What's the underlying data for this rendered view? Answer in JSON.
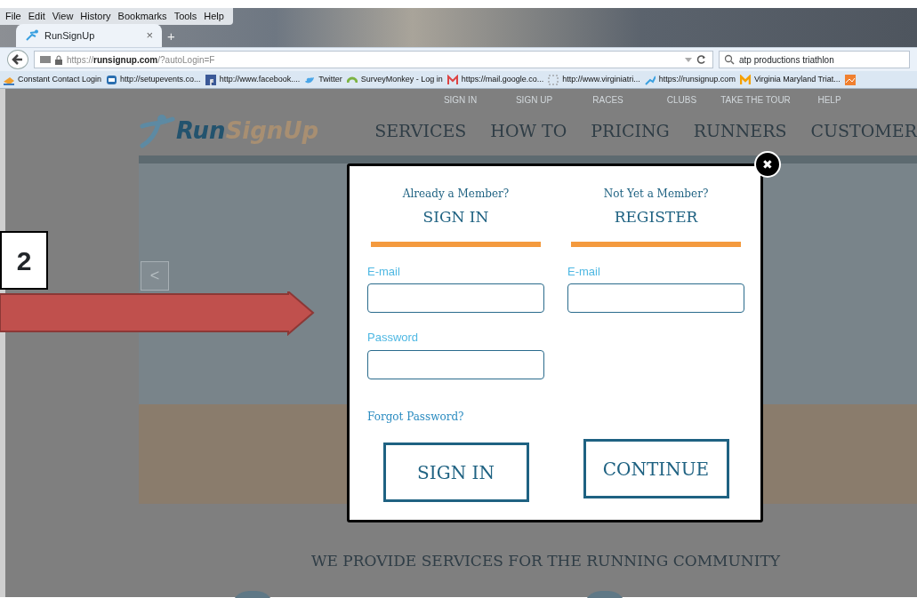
{
  "menu": [
    "File",
    "Edit",
    "View",
    "History",
    "Bookmarks",
    "Tools",
    "Help"
  ],
  "tab": {
    "title": "RunSignUp",
    "close": "×"
  },
  "new_tab": "+",
  "address": {
    "host_prefix": "https://",
    "host": "runsignup.com",
    "path": "/?autoLogin=F"
  },
  "search": {
    "value": "atp productions triathlon"
  },
  "bookmarks": [
    {
      "label": "Constant Contact Login"
    },
    {
      "label": "http://setupevents.co..."
    },
    {
      "label": "http://www.facebook...."
    },
    {
      "label": "Twitter"
    },
    {
      "label": "SurveyMonkey - Log in"
    },
    {
      "label": "https://mail.google.co..."
    },
    {
      "label": "http://www.virginiatri..."
    },
    {
      "label": "https://runsignup.com"
    },
    {
      "label": "Virginia Maryland Triat..."
    }
  ],
  "site": {
    "top_links": [
      "SIGN IN",
      "SIGN UP",
      "RACES",
      "CLUBS",
      "TAKE THE TOUR",
      "HELP"
    ],
    "logo": {
      "first": "Run",
      "second": "SignUp"
    },
    "nav": [
      "SERVICES",
      "HOW TO",
      "PRICING",
      "RUNNERS",
      "CUSTOMER"
    ],
    "slider_prev": "<",
    "headline": "WE PROVIDE SERVICES FOR THE RUNNING COMMUNITY"
  },
  "annotation": {
    "step": "2"
  },
  "modal": {
    "close": "✖",
    "sign_in": {
      "kicker": "Already a Member?",
      "title": "SIGN IN",
      "fields": [
        {
          "label": "E-mail"
        },
        {
          "label": "Password"
        }
      ],
      "forgot": "Forgot Password?",
      "button": "SIGN IN"
    },
    "register": {
      "kicker": "Not Yet a Member?",
      "title": "REGISTER",
      "fields": [
        {
          "label": "E-mail"
        }
      ],
      "button": "CONTINUE"
    }
  }
}
